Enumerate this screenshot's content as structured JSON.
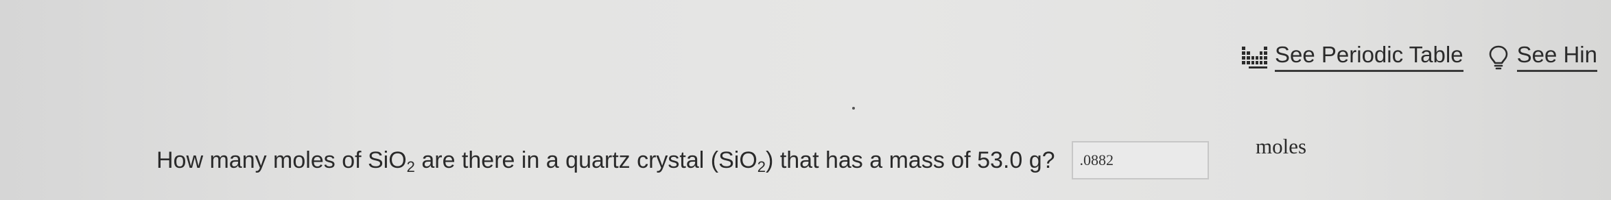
{
  "toolbar": {
    "periodic_table_label": "See Periodic Table",
    "hint_label": "See Hin"
  },
  "question": {
    "prefix": "How many moles of SiO",
    "formula_sub_1": "2",
    "middle": " are there in a quartz crystal (SiO",
    "formula_sub_2": "2",
    "suffix": ") that has a mass of 53.0  g?",
    "answer_value": ".0882",
    "unit_label": "moles"
  },
  "colors": {
    "background": "#e4e4e3",
    "text": "#2a2a2a",
    "input_border": "#c7c7c7"
  },
  "icons": [
    "periodic-table-icon",
    "lightbulb-icon"
  ]
}
